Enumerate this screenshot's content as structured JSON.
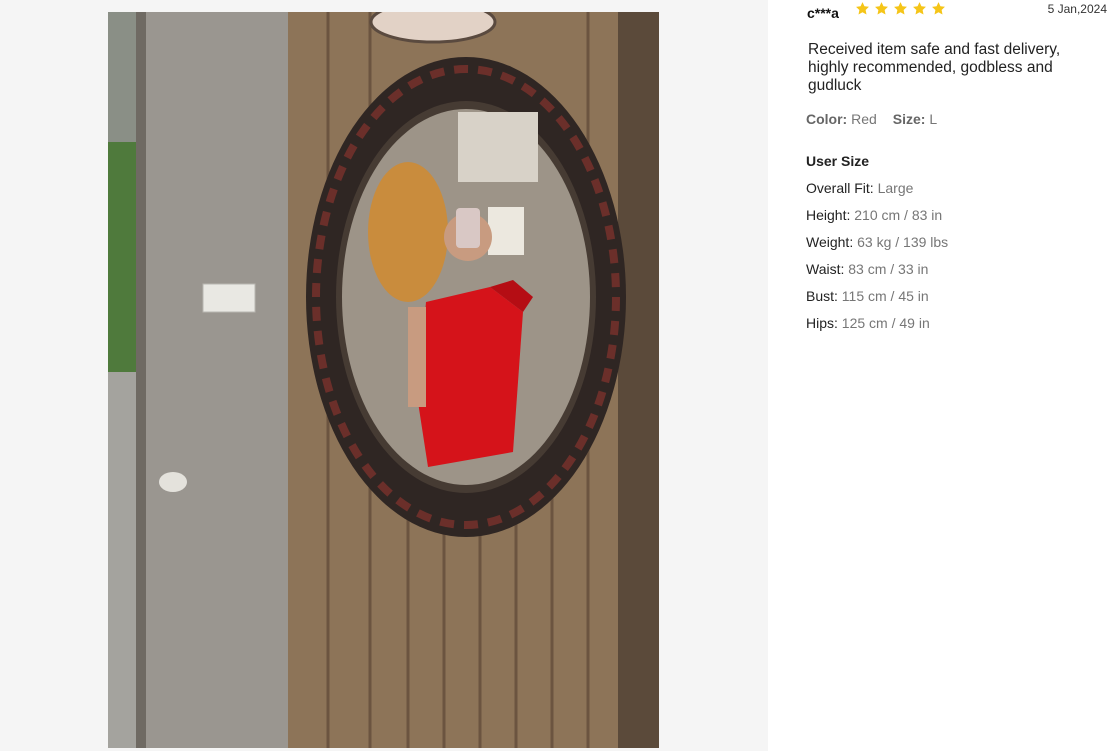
{
  "review": {
    "reviewer": "c***a",
    "rating": 5,
    "rating_max": 5,
    "star_color": "#f5c518",
    "date": "5 Jan,2024",
    "text": "Received item safe and fast delivery, highly recommended, godbless and gudluck",
    "color_label": "Color:",
    "color_value": "Red",
    "size_label": "Size:",
    "size_value": "L"
  },
  "user_size": {
    "title": "User Size",
    "items": [
      {
        "label": "Overall Fit:",
        "value": "Large"
      },
      {
        "label": "Height:",
        "value": "210 cm / 83 in"
      },
      {
        "label": "Weight:",
        "value": "63 kg / 139 lbs"
      },
      {
        "label": "Waist:",
        "value": "83 cm / 33 in"
      },
      {
        "label": "Bust:",
        "value": "115 cm / 45 in"
      },
      {
        "label": "Hips:",
        "value": "125 cm / 49 in"
      }
    ]
  }
}
